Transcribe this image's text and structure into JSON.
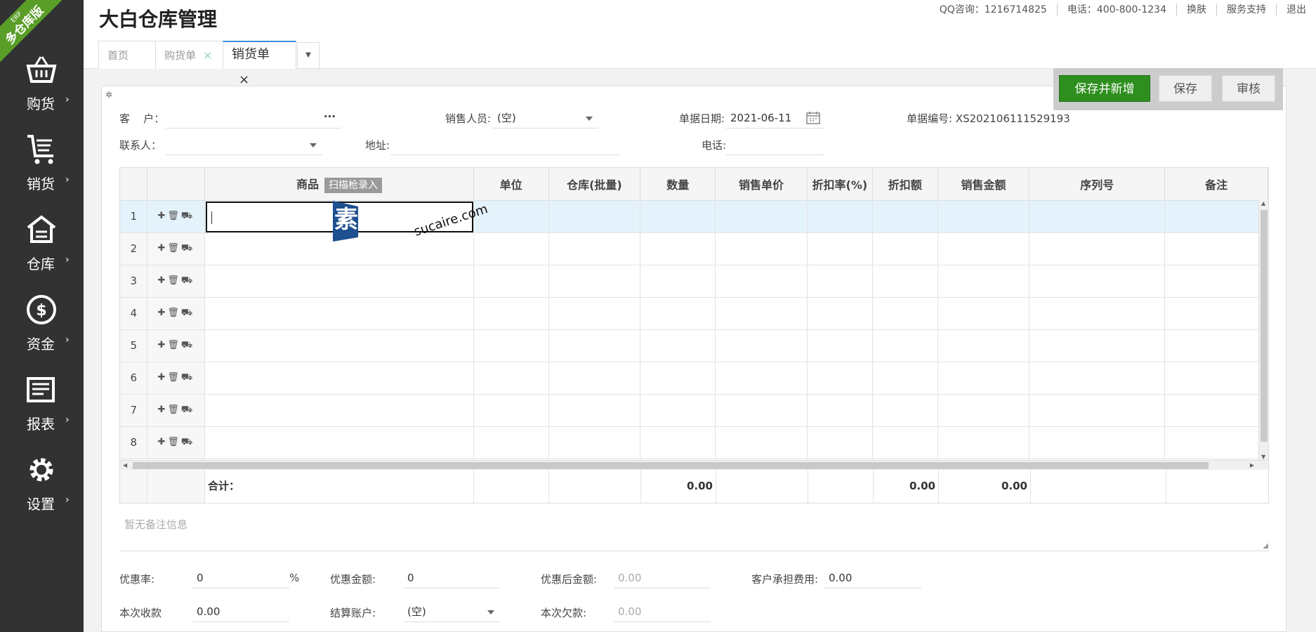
{
  "sidebar": {
    "ribbon_small": "ERP",
    "ribbon_big": "多仓库版",
    "items": [
      {
        "label": "购货",
        "icon": "basket-icon"
      },
      {
        "label": "销货",
        "icon": "cart-icon"
      },
      {
        "label": "仓库",
        "icon": "warehouse-icon"
      },
      {
        "label": "资金",
        "icon": "dollar-icon"
      },
      {
        "label": "报表",
        "icon": "report-icon"
      },
      {
        "label": "设置",
        "icon": "gear-icon"
      }
    ]
  },
  "header": {
    "title": "大白仓库管理",
    "links": [
      "QQ咨询：1216714825",
      "电话：400-800-1234",
      "换肤",
      "服务支持",
      "退出"
    ]
  },
  "tabs": [
    {
      "label": "首页"
    },
    {
      "label": "购货单"
    },
    {
      "label": "销货单"
    }
  ],
  "actions": {
    "save_new": "保存并新增",
    "save": "保存",
    "audit": "审核"
  },
  "form": {
    "customer_label": "客    户：",
    "customer_value": "",
    "salesperson_label": "销售人员:",
    "salesperson_value": "(空)",
    "date_label": "单据日期:",
    "date_value": "2021-06-11",
    "docno_label": "单据编号: XS202106111529193",
    "contact_label": "联系人：",
    "address_label": "地址:",
    "phone_label": "电话:"
  },
  "grid": {
    "headers": {
      "product": "商品",
      "scan": "扫描枪录入",
      "unit": "单位",
      "warehouse": "仓库(批量)",
      "qty": "数量",
      "price": "销售单价",
      "discount_rate": "折扣率(%)",
      "discount_amt": "折扣额",
      "amount": "销售金额",
      "serial": "序列号",
      "note": "备注"
    },
    "rows": [
      "1",
      "2",
      "3",
      "4",
      "5",
      "6",
      "7",
      "8"
    ],
    "footer": {
      "label": "合计：",
      "qty": "0.00",
      "discount": "0.00",
      "amount": "0.00"
    }
  },
  "remark_placeholder": "暂无备注信息",
  "bottom": {
    "discount_rate_label": "优惠率:",
    "discount_rate_value": "0",
    "percent": "%",
    "discount_amount_label": "优惠金额:",
    "discount_amount_value": "0",
    "after_discount_label": "优惠后金额:",
    "after_discount_value": "0.00",
    "customer_fee_label": "客户承担费用:",
    "customer_fee_value": "0.00",
    "received_label": "本次收款",
    "received_value": "0.00",
    "account_label": "结算账户:",
    "account_value": "(空)",
    "debt_label": "本次欠款:",
    "debt_value": "0.00"
  },
  "watermark": {
    "cn": "素材熱",
    "en": "sucaire.com"
  },
  "colors": {
    "sidebar": "#323232",
    "accent_green": "#2e8f1e",
    "selected_row": "#e4f2fb"
  }
}
